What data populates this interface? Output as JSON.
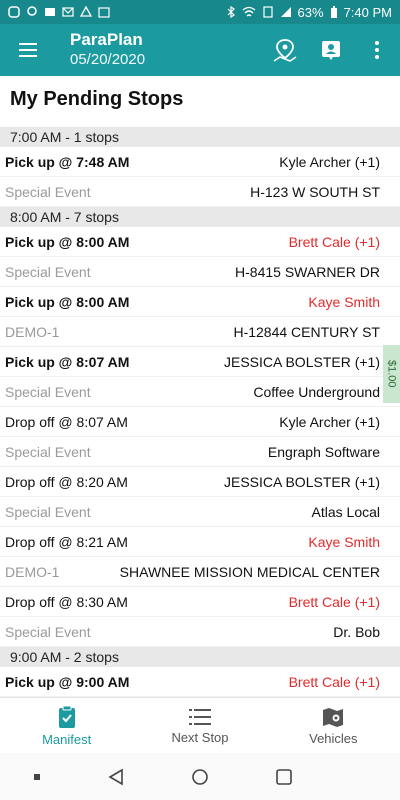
{
  "status_bar": {
    "battery": "63%",
    "time": "7:40 PM"
  },
  "app_bar": {
    "title": "ParaPlan",
    "date": "05/20/2020"
  },
  "page_title": "My Pending Stops",
  "side_tab": "$1.00",
  "list": [
    {
      "type": "header",
      "text": "7:00 AM - 1 stops"
    },
    {
      "type": "row",
      "left": "Pick up @ 7:48 AM",
      "left_style": "bold",
      "right": "Kyle Archer (+1)",
      "right_style": "dark"
    },
    {
      "type": "row",
      "left": "Special Event",
      "left_style": "muted",
      "right": "H-123 W SOUTH ST",
      "right_style": "dark"
    },
    {
      "type": "header",
      "text": "8:00 AM - 7 stops"
    },
    {
      "type": "row",
      "left": "Pick up @ 8:00 AM",
      "left_style": "bold",
      "right": "Brett Cale (+1)",
      "right_style": "red"
    },
    {
      "type": "row",
      "left": "Special Event",
      "left_style": "muted",
      "right": "H-8415 SWARNER DR",
      "right_style": "dark"
    },
    {
      "type": "row",
      "left": "Pick up @ 8:00 AM",
      "left_style": "bold",
      "right": "Kaye Smith",
      "right_style": "red"
    },
    {
      "type": "row",
      "left": "DEMO-1",
      "left_style": "muted",
      "right": "H-12844 CENTURY ST",
      "right_style": "dark"
    },
    {
      "type": "row",
      "left": "Pick up @ 8:07 AM",
      "left_style": "bold",
      "right": "JESSICA BOLSTER (+1)",
      "right_style": "dark"
    },
    {
      "type": "row",
      "left": "Special Event",
      "left_style": "muted",
      "right": "Coffee Underground",
      "right_style": "dark"
    },
    {
      "type": "row",
      "left": "Drop off @ 8:07 AM",
      "left_style": "dark",
      "right": "Kyle Archer (+1)",
      "right_style": "dark"
    },
    {
      "type": "row",
      "left": "Special Event",
      "left_style": "muted",
      "right": "Engraph Software",
      "right_style": "dark"
    },
    {
      "type": "row",
      "left": "Drop off @ 8:20 AM",
      "left_style": "dark",
      "right": "JESSICA BOLSTER (+1)",
      "right_style": "dark"
    },
    {
      "type": "row",
      "left": "Special Event",
      "left_style": "muted",
      "right": "Atlas Local",
      "right_style": "dark"
    },
    {
      "type": "row",
      "left": "Drop off @ 8:21 AM",
      "left_style": "dark",
      "right": "Kaye Smith",
      "right_style": "red"
    },
    {
      "type": "row",
      "left": "DEMO-1",
      "left_style": "muted",
      "right": "SHAWNEE MISSION MEDICAL CENTER",
      "right_style": "dark"
    },
    {
      "type": "row",
      "left": "Drop off @ 8:30 AM",
      "left_style": "dark",
      "right": "Brett Cale (+1)",
      "right_style": "red"
    },
    {
      "type": "row",
      "left": "Special Event",
      "left_style": "muted",
      "right": "Dr. Bob",
      "right_style": "dark"
    },
    {
      "type": "header",
      "text": "9:00 AM - 2 stops"
    },
    {
      "type": "row",
      "left": "Pick up @ 9:00 AM",
      "left_style": "bold",
      "right": "Brett Cale (+1)",
      "right_style": "red"
    }
  ],
  "bottom_nav": [
    {
      "label": "Manifest",
      "icon": "clipboard-icon",
      "active": true
    },
    {
      "label": "Next Stop",
      "icon": "list-icon",
      "active": false
    },
    {
      "label": "Vehicles",
      "icon": "map-icon",
      "active": false
    }
  ],
  "colors": {
    "app_bar": "#1b9aa0",
    "status_bar": "#17898d",
    "accent": "#1b9aa0",
    "alert_red": "#e12b2b"
  }
}
